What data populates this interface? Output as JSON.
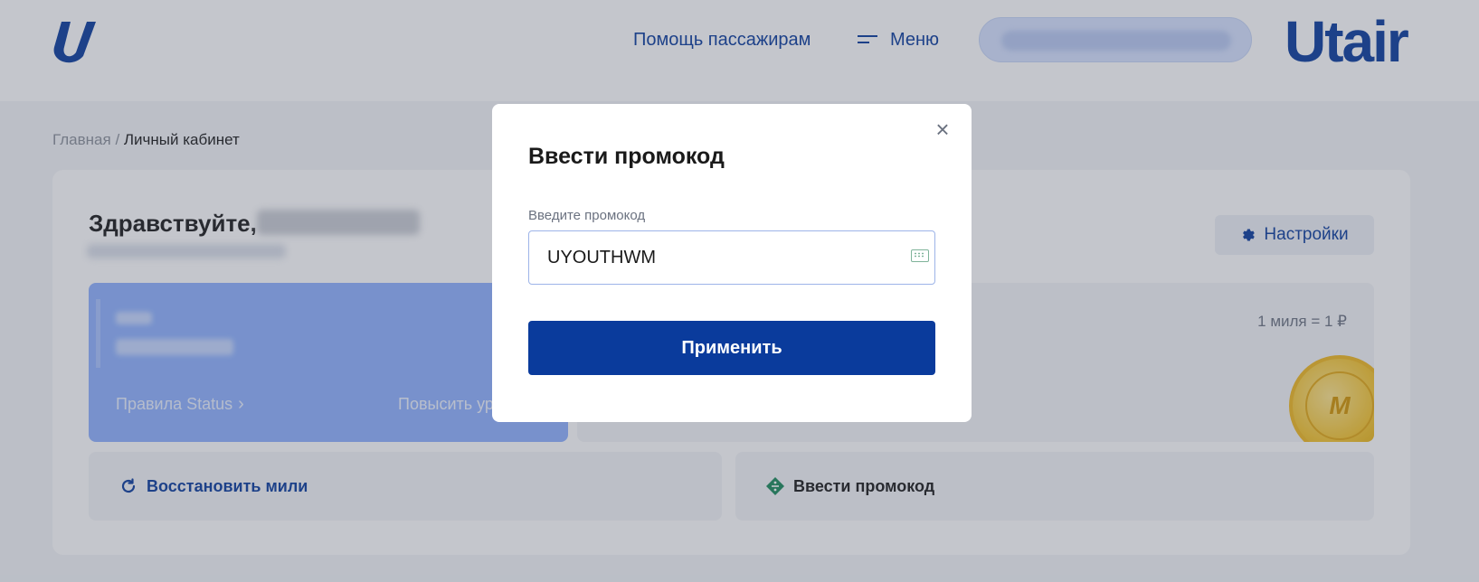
{
  "header": {
    "help_link": "Помощь пассажирам",
    "menu_label": "Меню",
    "brand": "Utair"
  },
  "breadcrumb": {
    "home": "Главная",
    "separator": " / ",
    "current": "Личный кабинет"
  },
  "profile": {
    "greeting": "Здравствуйте,",
    "settings_label": "Настройки"
  },
  "status_card": {
    "rules_label": "Правила Status",
    "upgrade_label": "Повысить ур"
  },
  "miles_card": {
    "rate": "1 миля = 1 ₽",
    "coin_glyph": "М"
  },
  "actions": {
    "restore_label": "Восстановить мили",
    "promo_label": "Ввести промокод"
  },
  "modal": {
    "title": "Ввести промокод",
    "field_label": "Введите промокод",
    "field_value": "UYOUTHWM",
    "apply_label": "Применить",
    "close_glyph": "×"
  },
  "colors": {
    "brand_blue": "#0a3b9c",
    "status_blue": "#8fb2ff",
    "promo_green": "#1a8a5a"
  }
}
